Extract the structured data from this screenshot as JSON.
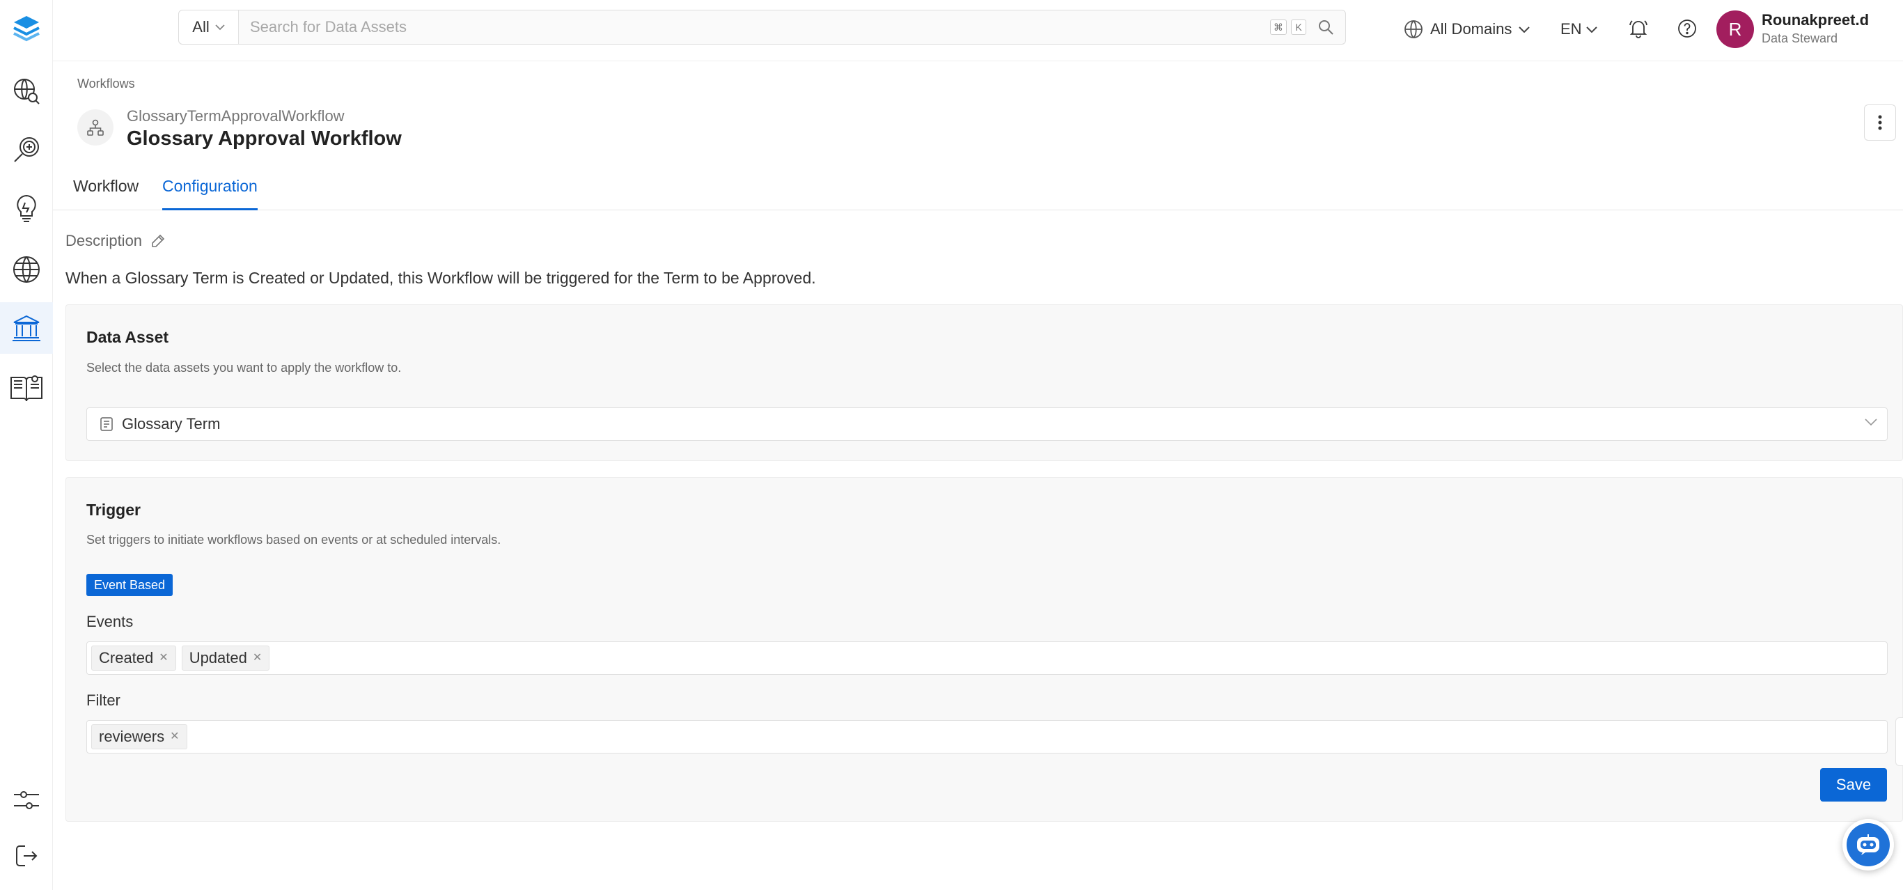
{
  "header": {
    "search_type": "All",
    "search_placeholder": "Search for Data Assets",
    "shortcut_cmd": "⌘",
    "shortcut_key": "K",
    "domains": "All Domains",
    "language": "EN",
    "user": {
      "initial": "R",
      "name": "Rounakpreet.d",
      "role": "Data Steward"
    }
  },
  "sidebar": {
    "items": [
      {
        "icon": "logo-layers-icon"
      },
      {
        "icon": "explore-icon"
      },
      {
        "icon": "data-observability-icon"
      },
      {
        "icon": "insights-bulb-icon"
      },
      {
        "icon": "domains-globe-icon"
      },
      {
        "icon": "governance-icon",
        "active": true
      },
      {
        "icon": "glossary-book-icon"
      },
      {
        "icon": "settings-sliders-icon"
      },
      {
        "icon": "logout-icon"
      }
    ]
  },
  "page": {
    "breadcrumb": "Workflows",
    "fqn": "GlossaryTermApprovalWorkflow",
    "title": "Glossary Approval Workflow",
    "tabs": [
      {
        "label": "Workflow",
        "active": false
      },
      {
        "label": "Configuration",
        "active": true
      }
    ],
    "description_label": "Description",
    "description": "When a Glossary Term is Created or Updated, this Workflow will be triggered for the Term to be Approved."
  },
  "data_asset": {
    "title": "Data Asset",
    "subtitle": "Select the data assets you want to apply the workflow to.",
    "selected": "Glossary Term"
  },
  "trigger": {
    "title": "Trigger",
    "subtitle": "Set triggers to initiate workflows based on events or at scheduled intervals.",
    "type_badge": "Event Based",
    "events_label": "Events",
    "events": [
      "Created",
      "Updated"
    ],
    "filter_label": "Filter",
    "filters": [
      "reviewers"
    ]
  },
  "actions": {
    "save": "Save"
  },
  "colors": {
    "primary": "#0b67d6",
    "avatar": "#a21e5e",
    "card_bg": "#f8f8f8"
  }
}
